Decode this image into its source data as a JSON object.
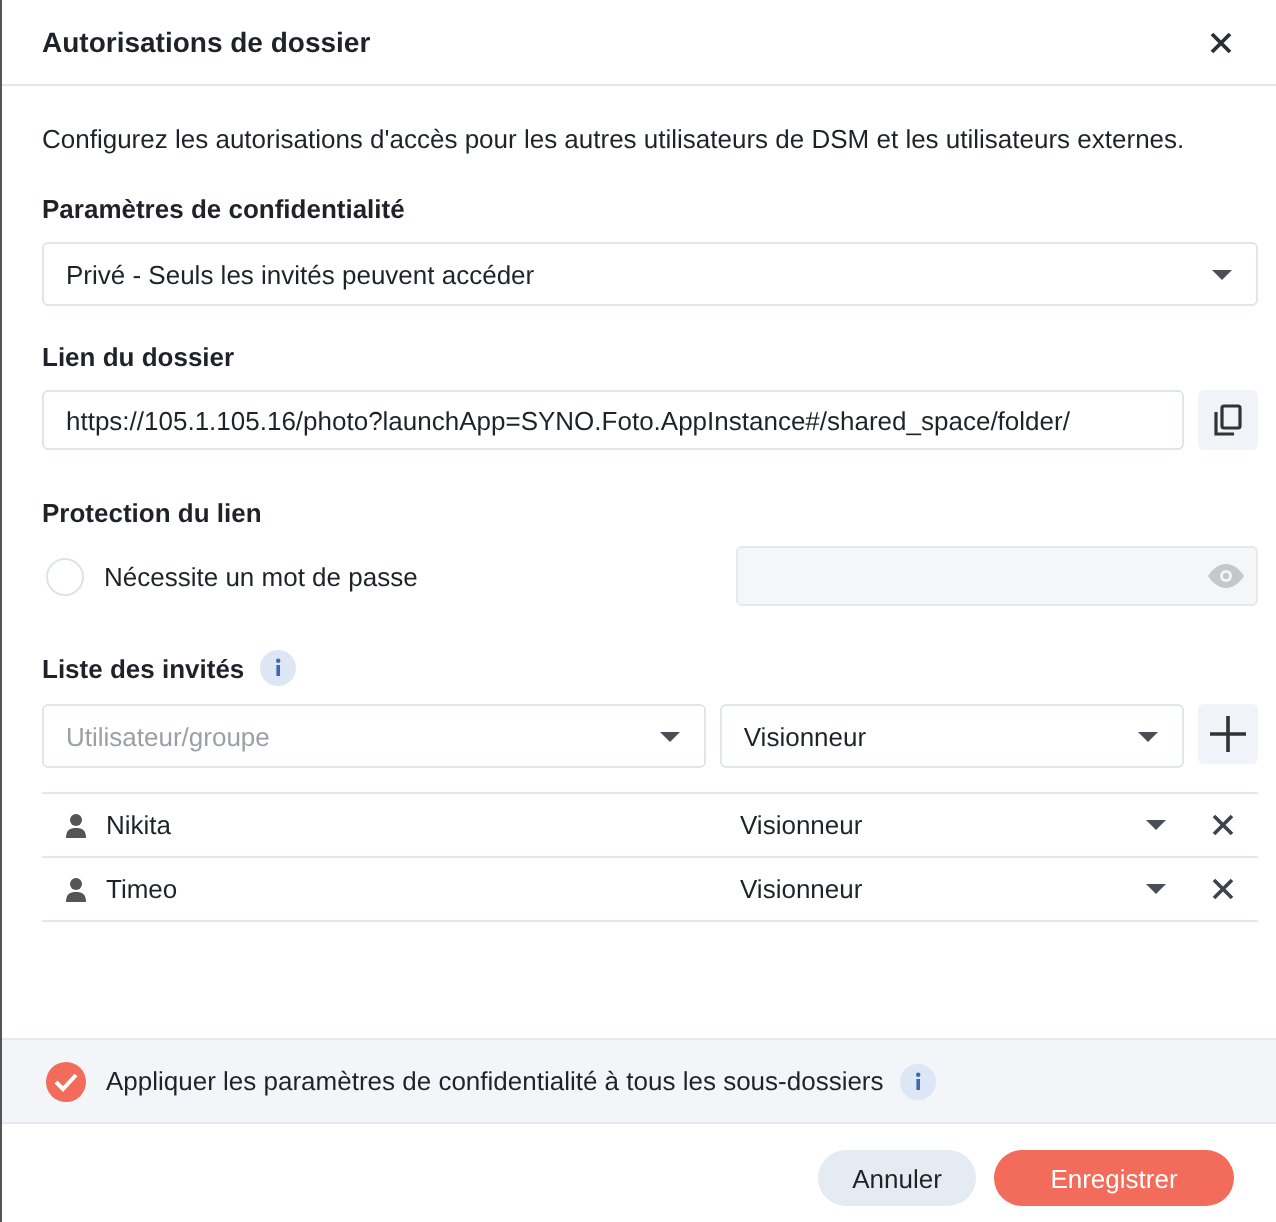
{
  "window": {
    "title": "Autorisations de dossier"
  },
  "description": "Configurez les autorisations d'accès pour les autres utilisateurs de DSM et les utilisateurs externes.",
  "privacy": {
    "label": "Paramètres de confidentialité",
    "value": "Privé - Seuls les invités peuvent accéder"
  },
  "folder_link": {
    "label": "Lien du dossier",
    "value": "https://105.1.105.16/photo?launchApp=SYNO.Foto.AppInstance#/shared_space/folder/"
  },
  "link_protection": {
    "label": "Protection du lien",
    "option": "Nécessite un mot de passe",
    "checked": false,
    "password_disabled": true
  },
  "guests": {
    "label": "Liste des invités",
    "user_placeholder": "Utilisateur/groupe",
    "role": "Visionneur",
    "rows": [
      {
        "name": "Nikita",
        "role": "Visionneur"
      },
      {
        "name": "Timeo",
        "role": "Visionneur"
      }
    ]
  },
  "apply_subfolders": {
    "label": "Appliquer les paramètres de confidentialité à tous les sous-dossiers",
    "checked": true
  },
  "buttons": {
    "cancel": "Annuler",
    "save": "Enregistrer"
  }
}
